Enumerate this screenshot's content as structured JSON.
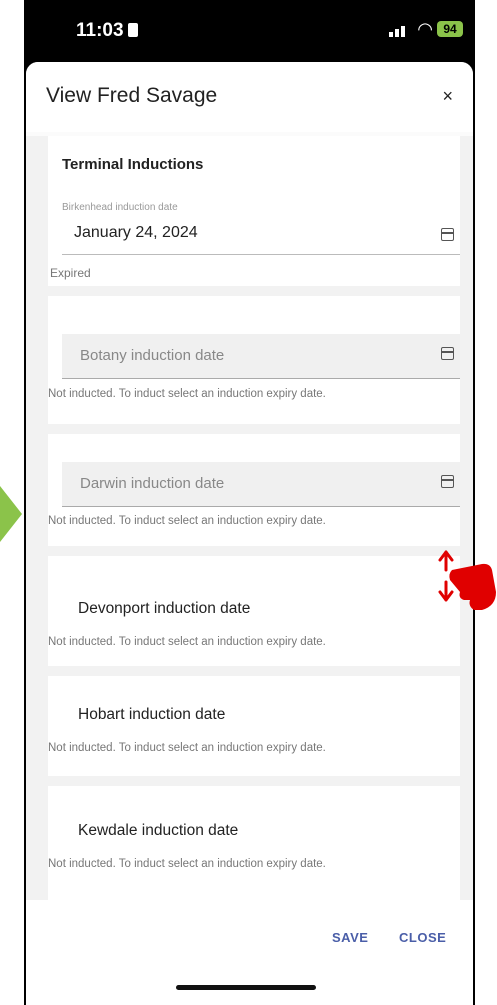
{
  "status_bar": {
    "time": "11:03",
    "battery": "94"
  },
  "dialog": {
    "title": "View Fred Savage",
    "close_symbol": "×"
  },
  "section": {
    "title": "Terminal Inductions"
  },
  "birkenhead": {
    "label": "Birkenhead induction date",
    "value": "January 24, 2024",
    "status": "Expired"
  },
  "botany": {
    "placeholder": "Botany induction date",
    "note": "Not inducted. To induct select an induction expiry date."
  },
  "darwin": {
    "placeholder": "Darwin induction date",
    "note": "Not inducted. To induct select an induction expiry date."
  },
  "devonport": {
    "label": "Devonport induction date",
    "note": "Not inducted. To induct select an induction expiry date."
  },
  "hobart": {
    "label": "Hobart induction date",
    "note": "Not inducted. To induct select an induction expiry date."
  },
  "kewdale": {
    "label": "Kewdale induction date",
    "note": "Not inducted. To induct select an induction expiry date."
  },
  "footer": {
    "save": "SAVE",
    "close": "CLOSE"
  },
  "colors": {
    "accent": "#4a5ea8",
    "gesture": "#e00000",
    "arrow": "#8bc34a"
  },
  "icons": [
    "calendar-icon",
    "close-icon",
    "scroll-gesture-icon"
  ]
}
